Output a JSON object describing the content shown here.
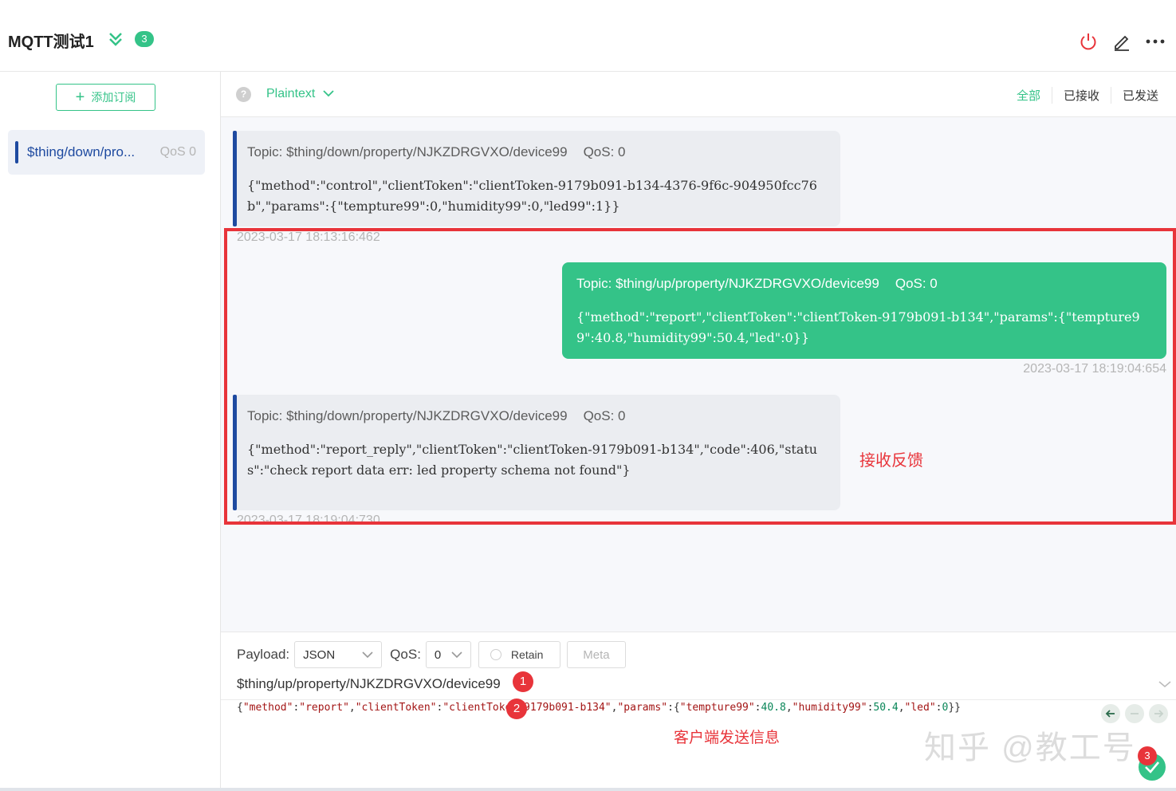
{
  "header": {
    "title": "MQTT测试1",
    "badge_count": "3",
    "accent": "#34c388",
    "power_color": "#e8343a"
  },
  "sidebar": {
    "add_button_label": "添加订阅",
    "subscription": {
      "topic": "$thing/down/pro...",
      "qos": "QoS 0",
      "color": "#1e4aa0"
    }
  },
  "toolbar": {
    "help_symbol": "?",
    "format": "Plaintext",
    "filters": [
      "全部",
      "已接收",
      "已发送"
    ],
    "active_filter": "全部"
  },
  "messages": [
    {
      "direction": "received",
      "topic": "Topic: $thing/down/property/NJKZDRGVXO/device99",
      "qos": "QoS: 0",
      "payload": "{\"method\":\"control\",\"clientToken\":\"clientToken-9179b091-b134-4376-9f6c-904950fcc76b\",\"params\":{\"tempture99\":0,\"humidity99\":0,\"led99\":1}}",
      "time": "2023-03-17 18:13:16:462"
    },
    {
      "direction": "sent",
      "topic": "Topic: $thing/up/property/NJKZDRGVXO/device99",
      "qos": "QoS: 0",
      "payload": "{\"method\":\"report\",\"clientToken\":\"clientToken-9179b091-b134\",\"params\":{\"tempture99\":40.8,\"humidity99\":50.4,\"led\":0}}",
      "time": "2023-03-17 18:19:04:654"
    },
    {
      "direction": "received",
      "topic": "Topic: $thing/down/property/NJKZDRGVXO/device99",
      "qos": "QoS: 0",
      "payload": "{\"method\":\"report_reply\",\"clientToken\":\"clientToken-9179b091-b134\",\"code\":406,\"status\":\"check report data err: led property schema not found\"}",
      "time": "2023-03-17 18:19:04:730"
    }
  ],
  "annotations": {
    "feedback_label": "接收反馈",
    "send_label": "客户端发送信息",
    "markers": [
      "1",
      "2",
      "3"
    ],
    "color": "#e8343a"
  },
  "publish": {
    "payload_label": "Payload:",
    "payload_type": "JSON",
    "qos_label": "QoS:",
    "qos_value": "0",
    "retain_label": "Retain",
    "meta_label": "Meta",
    "topic": "$thing/up/property/NJKZDRGVXO/device99",
    "payload_parts": [
      {
        "t": "{",
        "c": "p"
      },
      {
        "t": "\"method\"",
        "c": "s"
      },
      {
        "t": ":",
        "c": "p"
      },
      {
        "t": "\"report\"",
        "c": "s"
      },
      {
        "t": ",",
        "c": "p"
      },
      {
        "t": "\"clientToken\"",
        "c": "s"
      },
      {
        "t": ":",
        "c": "p"
      },
      {
        "t": "\"clientToken-9179b091-b134\"",
        "c": "s"
      },
      {
        "t": ",",
        "c": "p"
      },
      {
        "t": "\"params\"",
        "c": "s"
      },
      {
        "t": ":{",
        "c": "p"
      },
      {
        "t": "\"tempture99\"",
        "c": "s"
      },
      {
        "t": ":",
        "c": "p"
      },
      {
        "t": "40.8",
        "c": "n"
      },
      {
        "t": ",",
        "c": "p"
      },
      {
        "t": "\"humidity99\"",
        "c": "s"
      },
      {
        "t": ":",
        "c": "p"
      },
      {
        "t": "50.4",
        "c": "n"
      },
      {
        "t": ",",
        "c": "p"
      },
      {
        "t": "\"led\"",
        "c": "s"
      },
      {
        "t": ":",
        "c": "p"
      },
      {
        "t": "0",
        "c": "n"
      },
      {
        "t": "}}",
        "c": "p"
      }
    ]
  },
  "watermark": "知乎 @教工号"
}
